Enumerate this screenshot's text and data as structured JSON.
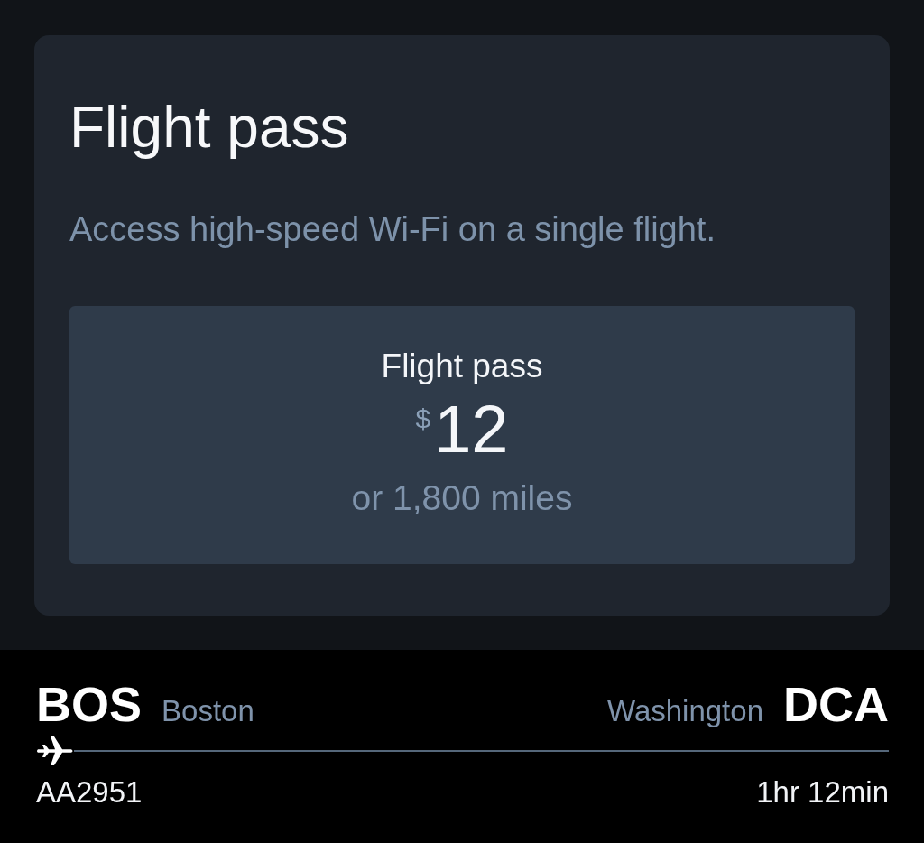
{
  "card": {
    "title": "Flight pass",
    "description": "Access high-speed Wi-Fi on a single flight.",
    "options": [
      {
        "name": "Flight pass",
        "currency": "$",
        "price": "12",
        "miles": "or 1,800 miles"
      }
    ]
  },
  "flight": {
    "origin": {
      "code": "BOS",
      "city": "Boston"
    },
    "destination": {
      "city": "Washington",
      "code": "DCA"
    },
    "flight_number": "AA2951",
    "duration": "1hr 12min"
  }
}
